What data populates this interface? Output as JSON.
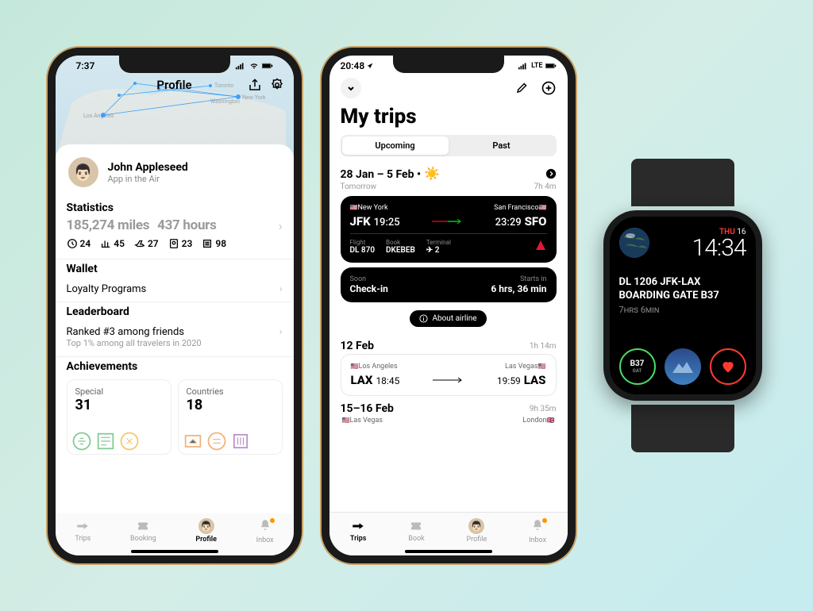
{
  "phone1": {
    "status_time": "7:37",
    "title": "Profile",
    "user": {
      "name": "John Appleseed",
      "sub": "App in the Air"
    },
    "statistics": {
      "title": "Statistics",
      "miles": "185,274 miles",
      "hours": "437 hours",
      "items": [
        {
          "icon": "clock",
          "val": "24"
        },
        {
          "icon": "chart",
          "val": "45"
        },
        {
          "icon": "plane",
          "val": "27"
        },
        {
          "icon": "passport",
          "val": "23"
        },
        {
          "icon": "list",
          "val": "98"
        }
      ]
    },
    "wallet": {
      "title": "Wallet",
      "link": "Loyalty Programs"
    },
    "leaderboard": {
      "title": "Leaderboard",
      "rank": "Ranked #3 among friends",
      "sub": "Top 1% among all travelers in 2020"
    },
    "achievements": {
      "title": "Achievements",
      "cards": [
        {
          "label": "Special",
          "num": "31"
        },
        {
          "label": "Countries",
          "num": "18"
        }
      ]
    },
    "tabs": [
      "Trips",
      "Booking",
      "Profile",
      "Inbox"
    ],
    "active_tab": 2,
    "map_cities": [
      "Toronto",
      "New York",
      "Washington",
      "Los Angeles"
    ]
  },
  "phone2": {
    "status_time": "20:48",
    "status_network": "LTE",
    "title": "My trips",
    "segments": [
      "Upcoming",
      "Past"
    ],
    "trip1": {
      "date": "28 Jan – 5 Feb •",
      "emoji": "☀️",
      "sub_left": "Tomorrow",
      "sub_right": "7h 4m",
      "from_city": "New York",
      "to_city": "San Francisco",
      "from_code": "JFK",
      "from_time": "19:25",
      "to_code": "SFO",
      "to_time": "23:29",
      "flight_label": "Flight",
      "flight_val": "DL 870",
      "book_label": "Book",
      "book_val": "DKEBEB",
      "terminal_label": "Terminal",
      "terminal_val": "2",
      "checkin_soon": "Soon",
      "checkin_label": "Check-in",
      "checkin_starts": "Starts in",
      "checkin_time": "6 hrs, 36 min",
      "about": "About airline"
    },
    "trip2": {
      "date": "12 Feb",
      "duration": "1h 14m",
      "from_city": "Los Angeles",
      "to_city": "Las Vegas",
      "from_code": "LAX",
      "from_time": "18:45",
      "to_code": "LAS",
      "to_time": "19:59"
    },
    "trip3": {
      "date": "15–16 Feb",
      "duration": "9h 35m",
      "from_city": "Las Vegas",
      "to_city": "London"
    },
    "tabs": [
      "Trips",
      "Book",
      "Profile",
      "Inbox"
    ],
    "active_tab": 0
  },
  "watch": {
    "day": "THU",
    "date": "16",
    "time": "14:34",
    "flight": "DL 1206 JFK-LAX",
    "gate": "BOARDING GATE B37",
    "eta": "7hrs 6min",
    "comp1": "B37",
    "comp1_sub": "GAT"
  }
}
